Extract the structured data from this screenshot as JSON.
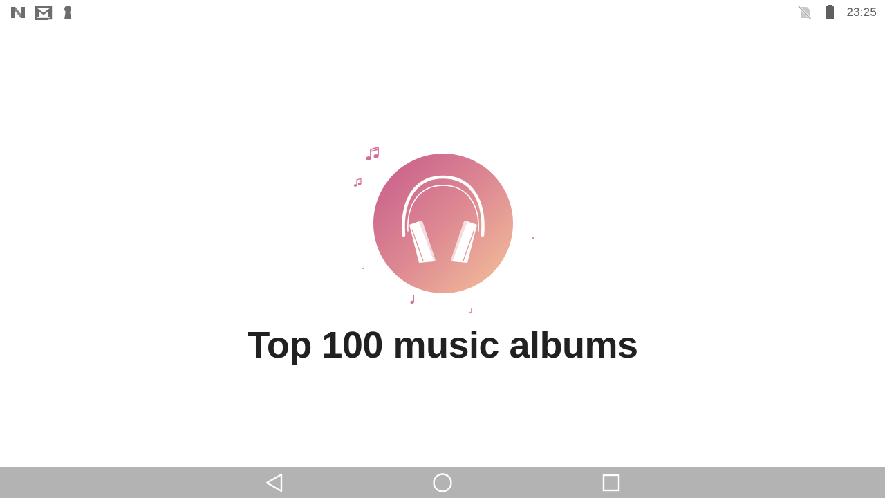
{
  "status_bar": {
    "time": "23:25",
    "left_icons": [
      "n-notification-icon",
      "gmail-icon",
      "keyhole-icon"
    ],
    "right_icons": [
      "no-sim-icon",
      "battery-icon"
    ]
  },
  "splash": {
    "title": "Top 100 music albums",
    "logo_icon": "headphones-icon",
    "gradient_start": "#ca6590",
    "gradient_end": "#f0b896",
    "note_color": "#d9709a"
  },
  "nav_bar": {
    "background": "#b3b3b3",
    "buttons": [
      "back-button",
      "home-button",
      "recents-button"
    ]
  }
}
